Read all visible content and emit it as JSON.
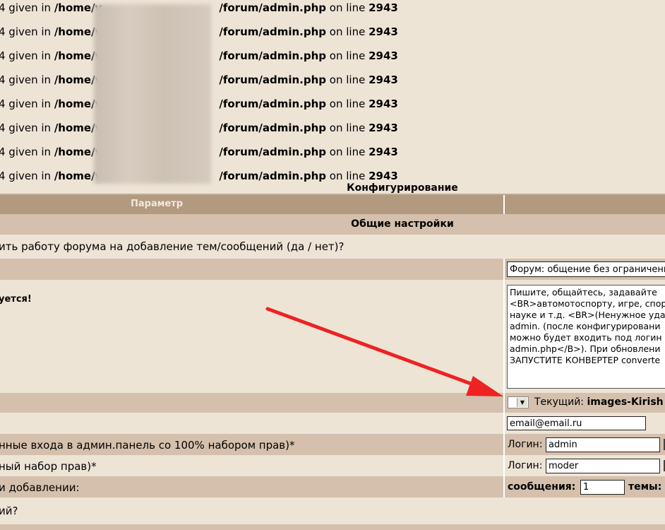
{
  "errors": [
    {
      "prefix": "4 given in ",
      "path_a": "/home/v",
      "path_b": "/forum/admin.php",
      "on_line": " on line ",
      "line": "2943"
    },
    {
      "prefix": "4 given in ",
      "path_a": "/home/v",
      "path_b": "/forum/admin.php",
      "on_line": " on line ",
      "line": "2943"
    },
    {
      "prefix": "4 given in ",
      "path_a": "/home/v",
      "path_b": "/forum/admin.php",
      "on_line": " on line ",
      "line": "2943"
    },
    {
      "prefix": "4 given in ",
      "path_a": "/home/v",
      "path_b": "/forum/admin.php",
      "on_line": " on line ",
      "line": "2943"
    },
    {
      "prefix": "4 given in ",
      "path_a": "/home/v",
      "path_b": "/forum/admin.php",
      "on_line": " on line ",
      "line": "2943"
    },
    {
      "prefix": "4 given in ",
      "path_a": "/home/v",
      "path_b": "/forum/admin.php",
      "on_line": " on line ",
      "line": "2943"
    },
    {
      "prefix": "4 given in ",
      "path_a": "/home/v",
      "path_b": "/forum/admin.php",
      "on_line": " on line ",
      "line": "2943"
    },
    {
      "prefix": "4 given in ",
      "path_a": "/home/v",
      "path_b": "/forum/admin.php",
      "on_line": " on line ",
      "line": "2943"
    }
  ],
  "config_title": "Конфигурирование",
  "header": {
    "param": "Параметр"
  },
  "section_general": "Общие настройки",
  "rows": {
    "stop_forum": "ить работу форума на добавление тем/сообщений (да / нет)?",
    "warning": "уется!",
    "admin_login_desc": "нные входа в админ.панель со 100% набором прав)*",
    "moder_desc": "ный набор прав)*",
    "on_add": "и добавлении:",
    "last": "ий?"
  },
  "fields": {
    "forum_title": "Форум: общение без ограничений",
    "description": "Пишите, общайтесь, задавайте\n<BR>автомотоспорту, игре, спор\nнауке и т.д. <BR>(Ненужное уда\nadmin. (после конфигурировани\nможно будет входить под логин\nadmin.php</B>). При обновлени\nЗАПУСТИТЕ КОНВЕРТЕР converte",
    "skin_current_label": "Текущий: ",
    "skin_current_value": "images-Kirish",
    "email": "email@email.ru",
    "login_label": "Логин:",
    "admin_login": "admin",
    "moder_login": "moder",
    "messages_label": "сообщения:",
    "messages_value": "1",
    "topics_label": "темы:"
  },
  "colors": {
    "background": "#ede4d6",
    "row_dark": "#d4c0ac",
    "row_light": "#ede4d6",
    "header": "#b29a80",
    "arrow": "#ee2222"
  }
}
